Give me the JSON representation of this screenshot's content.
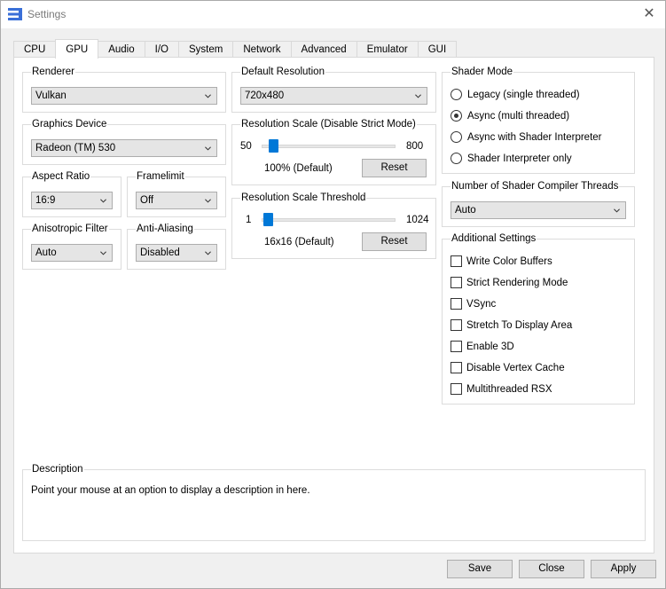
{
  "window": {
    "title": "Settings"
  },
  "tabs": [
    "CPU",
    "GPU",
    "Audio",
    "I/O",
    "System",
    "Network",
    "Advanced",
    "Emulator",
    "GUI"
  ],
  "active_tab": "GPU",
  "renderer": {
    "label": "Renderer",
    "value": "Vulkan"
  },
  "graphics_device": {
    "label": "Graphics Device",
    "value": "Radeon (TM) 530"
  },
  "aspect_ratio": {
    "label": "Aspect Ratio",
    "value": "16:9"
  },
  "framelimit": {
    "label": "Framelimit",
    "value": "Off"
  },
  "anisotropic_filter": {
    "label": "Anisotropic Filter",
    "value": "Auto"
  },
  "anti_aliasing": {
    "label": "Anti-Aliasing",
    "value": "Disabled"
  },
  "default_resolution": {
    "label": "Default Resolution",
    "value": "720x480"
  },
  "resolution_scale": {
    "label": "Resolution Scale (Disable Strict Mode)",
    "min": "50",
    "max": "800",
    "value_text": "100% (Default)",
    "reset": "Reset",
    "position_fraction": 0.0
  },
  "resolution_threshold": {
    "label": "Resolution Scale Threshold",
    "min": "1",
    "max": "1024",
    "value_text": "16x16 (Default)",
    "reset": "Reset",
    "position_fraction": 0.015
  },
  "shader_mode": {
    "label": "Shader Mode",
    "options": [
      {
        "label": "Legacy (single threaded)",
        "checked": false
      },
      {
        "label": "Async (multi threaded)",
        "checked": true
      },
      {
        "label": "Async with Shader Interpreter",
        "checked": false
      },
      {
        "label": "Shader Interpreter only",
        "checked": false
      }
    ]
  },
  "compiler_threads": {
    "label": "Number of Shader Compiler Threads",
    "value": "Auto"
  },
  "additional": {
    "label": "Additional Settings",
    "items": [
      {
        "label": "Write Color Buffers",
        "checked": false
      },
      {
        "label": "Strict Rendering Mode",
        "checked": false
      },
      {
        "label": "VSync",
        "checked": false
      },
      {
        "label": "Stretch To Display Area",
        "checked": false
      },
      {
        "label": "Enable 3D",
        "checked": false
      },
      {
        "label": "Disable Vertex Cache",
        "checked": false
      },
      {
        "label": "Multithreaded RSX",
        "checked": false
      }
    ]
  },
  "description": {
    "label": "Description",
    "text": "Point your mouse at an option to display a description in here."
  },
  "buttons": {
    "save": "Save",
    "close": "Close",
    "apply": "Apply"
  },
  "colors": {
    "accent": "#0078d7"
  }
}
